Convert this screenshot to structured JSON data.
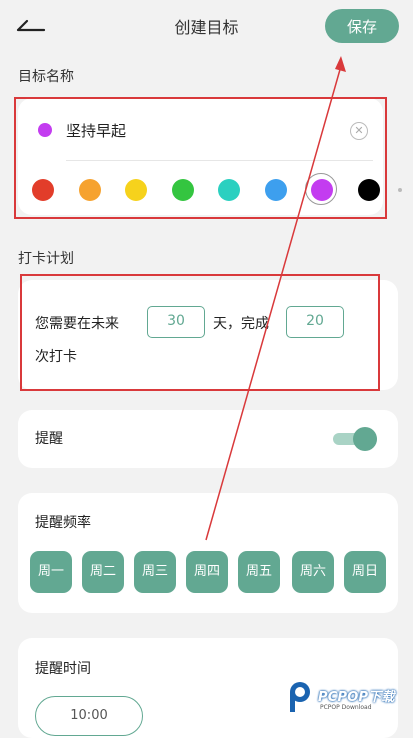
{
  "header": {
    "title": "创建目标",
    "save_label": "保存"
  },
  "name_section": {
    "label": "目标名称",
    "goal_name": "坚持早起",
    "selected_color": "#c33cf0",
    "colors": [
      {
        "name": "red",
        "hex": "#e23d2a"
      },
      {
        "name": "orange",
        "hex": "#f6a22f"
      },
      {
        "name": "yellow",
        "hex": "#f6d21c"
      },
      {
        "name": "green",
        "hex": "#34c540"
      },
      {
        "name": "teal",
        "hex": "#2bd0c0"
      },
      {
        "name": "blue",
        "hex": "#3d9fee"
      },
      {
        "name": "purple",
        "hex": "#c33cf0",
        "selected": true
      },
      {
        "name": "black",
        "hex": "#000000"
      }
    ]
  },
  "plan_section": {
    "label": "打卡计划",
    "prefix": "您需要在未来",
    "days_value": "30",
    "middle": "天，完成",
    "count_value": "20",
    "suffix": "次打卡"
  },
  "reminder": {
    "label": "提醒",
    "enabled": true
  },
  "frequency": {
    "label": "提醒频率",
    "days": [
      "周一",
      "周二",
      "周三",
      "周四",
      "周五",
      "周六",
      "周日"
    ]
  },
  "time": {
    "label": "提醒时间",
    "value": "10:00"
  },
  "colors": {
    "accent": "#62a892",
    "annotation": "#d9393b"
  },
  "watermark": {
    "text": "PCPOP下载",
    "subtext": "PCPOP Download"
  }
}
